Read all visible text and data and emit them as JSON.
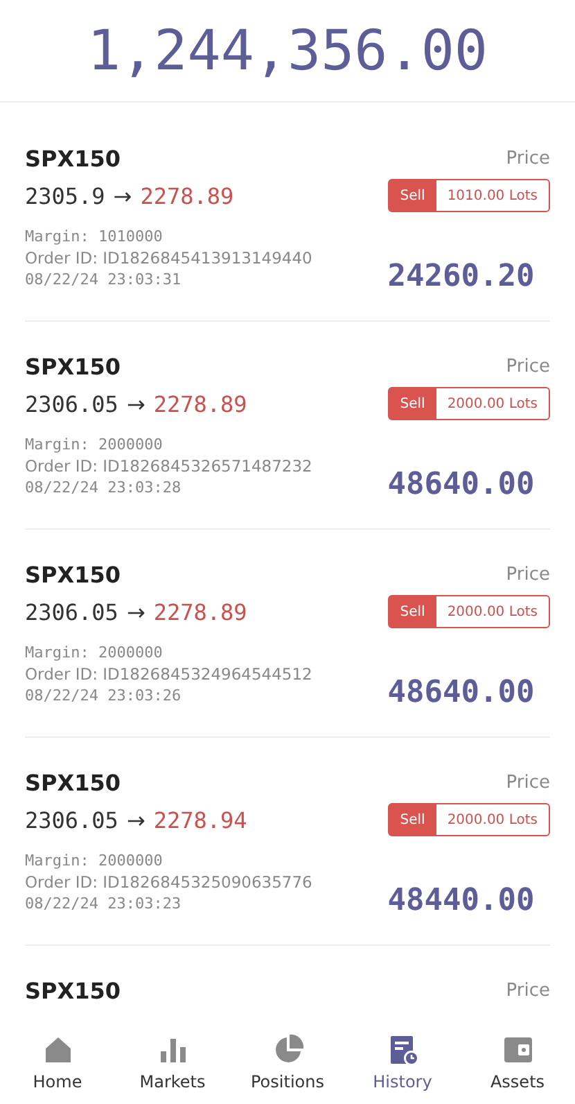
{
  "balance": "1,244,356.00",
  "orders": [
    {
      "symbol": "SPX150",
      "price_label": "Price",
      "open_price": "2305.9",
      "arrow": "→",
      "close_price": "2278.89",
      "side": "Sell",
      "lots": "1010.00 Lots",
      "margin": "Margin: 1010000",
      "order_id": "Order ID: ID1826845413913149440",
      "time": "08/22/24 23:03:31",
      "amount": "24260.20"
    },
    {
      "symbol": "SPX150",
      "price_label": "Price",
      "open_price": "2306.05",
      "arrow": "→",
      "close_price": "2278.89",
      "side": "Sell",
      "lots": "2000.00 Lots",
      "margin": "Margin: 2000000",
      "order_id": "Order ID: ID1826845326571487232",
      "time": "08/22/24 23:03:28",
      "amount": "48640.00"
    },
    {
      "symbol": "SPX150",
      "price_label": "Price",
      "open_price": "2306.05",
      "arrow": "→",
      "close_price": "2278.89",
      "side": "Sell",
      "lots": "2000.00 Lots",
      "margin": "Margin: 2000000",
      "order_id": "Order ID: ID1826845324964544512",
      "time": "08/22/24 23:03:26",
      "amount": "48640.00"
    },
    {
      "symbol": "SPX150",
      "price_label": "Price",
      "open_price": "2306.05",
      "arrow": "→",
      "close_price": "2278.94",
      "side": "Sell",
      "lots": "2000.00 Lots",
      "margin": "Margin: 2000000",
      "order_id": "Order ID: ID1826845325090635776",
      "time": "08/22/24 23:03:23",
      "amount": "48440.00"
    },
    {
      "symbol": "SPX150",
      "price_label": "Price"
    }
  ],
  "nav": [
    {
      "kind": "home",
      "label": "Home",
      "selected": false
    },
    {
      "kind": "markets",
      "label": "Markets",
      "selected": false
    },
    {
      "kind": "positions",
      "label": "Positions",
      "selected": false
    },
    {
      "kind": "history",
      "label": "History",
      "selected": true
    },
    {
      "kind": "assets",
      "label": "Assets",
      "selected": false
    }
  ]
}
